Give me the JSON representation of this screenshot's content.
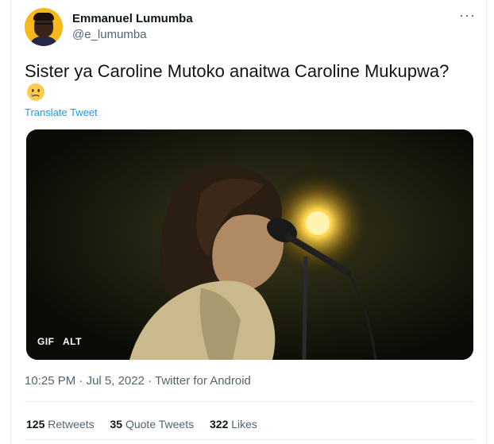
{
  "author": {
    "name": "Emmanuel Lumumba",
    "handle": "@e_lumumba"
  },
  "more_icon": "more-horizontal-icon",
  "more_glyph": "···",
  "tweet": {
    "text": "Sister ya Caroline Mutoko anaitwa Caroline Mukupwa?",
    "emoji": "face-holding-back-tears",
    "translate_label": "Translate Tweet"
  },
  "media": {
    "gif_label": "GIF",
    "alt_label": "ALT"
  },
  "meta": {
    "time": "10:25 PM",
    "sep1": " · ",
    "date": "Jul 5, 2022",
    "sep2": " · ",
    "client": "Twitter for Android"
  },
  "stats": {
    "retweets_count": "125",
    "retweets_label": "Retweets",
    "quotes_count": "35",
    "quotes_label": "Quote Tweets",
    "likes_count": "322",
    "likes_label": "Likes"
  },
  "colors": {
    "link": "#1d9bf0",
    "secondary_text": "#536471",
    "primary_text": "#0f1419",
    "divider": "#e6ecf0"
  }
}
